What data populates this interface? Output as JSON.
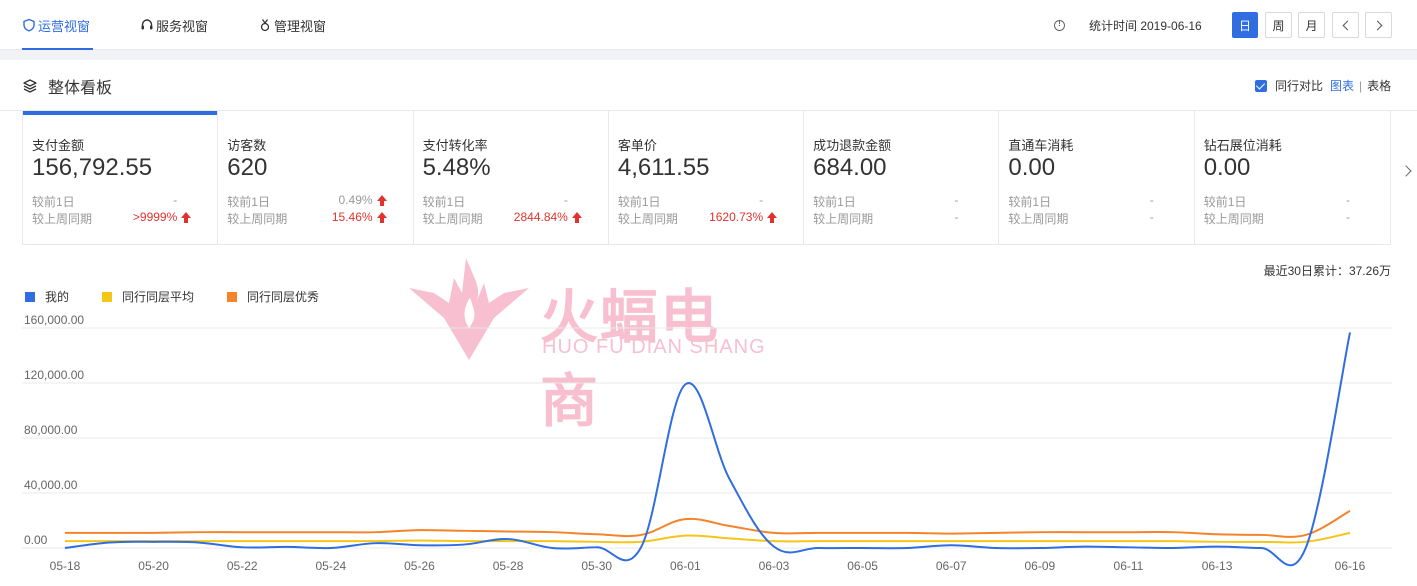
{
  "nav": {
    "tabs": [
      {
        "label": "运营视窗",
        "icon": "shield-icon",
        "active": true
      },
      {
        "label": "服务视窗",
        "icon": "headset-icon",
        "active": false
      },
      {
        "label": "管理视窗",
        "icon": "medal-icon",
        "active": false
      }
    ],
    "stat_time_label": "统计时间 2019-06-16",
    "period_buttons": [
      "日",
      "周",
      "月"
    ],
    "active_period": "日"
  },
  "panel": {
    "title": "整体看板",
    "compare_label": "同行对比",
    "view_chart": "图表",
    "view_sep": "|",
    "view_table": "表格"
  },
  "cards": [
    {
      "label": "支付金额",
      "value": "156,792.55",
      "prev_day_label": "较前1日",
      "prev_day": "-",
      "prev_week_label": "较上周同期",
      "prev_week": ">9999%",
      "prev_day_up": false,
      "prev_week_up": true
    },
    {
      "label": "访客数",
      "value": "620",
      "prev_day_label": "较前1日",
      "prev_day": "0.49%",
      "prev_week_label": "较上周同期",
      "prev_week": "15.46%",
      "prev_day_up": true,
      "prev_week_up": true
    },
    {
      "label": "支付转化率",
      "value": "5.48%",
      "prev_day_label": "较前1日",
      "prev_day": "-",
      "prev_week_label": "较上周同期",
      "prev_week": "2844.84%",
      "prev_day_up": false,
      "prev_week_up": true
    },
    {
      "label": "客单价",
      "value": "4,611.55",
      "prev_day_label": "较前1日",
      "prev_day": "-",
      "prev_week_label": "较上周同期",
      "prev_week": "1620.73%",
      "prev_day_up": false,
      "prev_week_up": true
    },
    {
      "label": "成功退款金额",
      "value": "684.00",
      "prev_day_label": "较前1日",
      "prev_day": "-",
      "prev_week_label": "较上周同期",
      "prev_week": "-",
      "prev_day_up": false,
      "prev_week_up": false
    },
    {
      "label": "直通车消耗",
      "value": "0.00",
      "prev_day_label": "较前1日",
      "prev_day": "-",
      "prev_week_label": "较上周同期",
      "prev_week": "-",
      "prev_day_up": false,
      "prev_week_up": false
    },
    {
      "label": "钻石展位消耗",
      "value": "0.00",
      "prev_day_label": "较前1日",
      "prev_day": "-",
      "prev_week_label": "较上周同期",
      "prev_week": "-",
      "prev_day_up": false,
      "prev_week_up": false
    }
  ],
  "watermark": {
    "text": "火蝠电商",
    "sub": "HUO FU DIAN SHANG"
  },
  "chart_summary": "最近30日累计：37.26万",
  "chart_data": {
    "type": "line",
    "x": [
      "05-18",
      "05-19",
      "05-20",
      "05-21",
      "05-22",
      "05-23",
      "05-24",
      "05-25",
      "05-26",
      "05-27",
      "05-28",
      "05-29",
      "05-30",
      "05-31",
      "06-01",
      "06-02",
      "06-03",
      "06-04",
      "06-05",
      "06-06",
      "06-07",
      "06-08",
      "06-09",
      "06-10",
      "06-11",
      "06-12",
      "06-13",
      "06-14",
      "06-15",
      "06-16"
    ],
    "x_ticks": [
      "05-18",
      "05-20",
      "05-22",
      "05-24",
      "05-26",
      "05-28",
      "05-30",
      "06-01",
      "06-03",
      "06-05",
      "06-07",
      "06-09",
      "06-11",
      "06-13",
      "06-16"
    ],
    "ylim": [
      0,
      160000
    ],
    "y_ticks": [
      "0.00",
      "40,000.00",
      "80,000.00",
      "120,000.00",
      "160,000.00"
    ],
    "y_tick_values": [
      0,
      40000,
      80000,
      120000,
      160000
    ],
    "grid": true,
    "legend_position": "top-left",
    "series": [
      {
        "name": "我的",
        "color": "#2f6de0",
        "values": [
          0,
          4000,
          4500,
          4000,
          500,
          800,
          0,
          3500,
          2000,
          2500,
          6500,
          0,
          500,
          500,
          119000,
          50000,
          1000,
          0,
          0,
          0,
          2000,
          0,
          0,
          1000,
          500,
          0,
          1000,
          0,
          0,
          156792
        ]
      },
      {
        "name": "同行同层平均",
        "color": "#f5c518",
        "values": [
          5000,
          5000,
          5000,
          5000,
          5000,
          5000,
          5000,
          5000,
          5500,
          5000,
          5000,
          5000,
          4500,
          4500,
          9000,
          7000,
          5000,
          5000,
          5000,
          5000,
          5000,
          5000,
          5000,
          5000,
          5000,
          5000,
          4500,
          4500,
          4500,
          11000
        ]
      },
      {
        "name": "同行同层优秀",
        "color": "#f5832a",
        "values": [
          11000,
          11000,
          11000,
          11500,
          11500,
          11500,
          11500,
          11500,
          13000,
          12500,
          12000,
          11500,
          10000,
          9500,
          21000,
          16000,
          11000,
          11000,
          11000,
          11000,
          10500,
          11000,
          11500,
          11500,
          11500,
          11500,
          10000,
          9500,
          9500,
          27000
        ]
      }
    ]
  }
}
